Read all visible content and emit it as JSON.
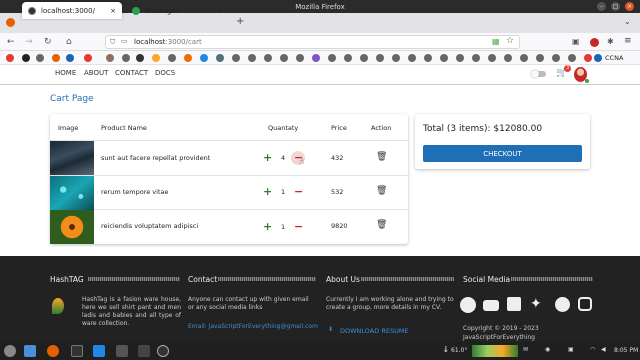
{
  "window": {
    "title": "Mozilla Firefox"
  },
  "tabs": [
    {
      "label": "localhost:3000/"
    },
    {
      "label": "Messages"
    }
  ],
  "url": {
    "host": "localhost",
    "rest": ":3000/cart"
  },
  "bookmarks": {
    "last_label": "CCNA"
  },
  "app_nav": {
    "items": [
      "HOME",
      "ABOUT",
      "CONTACT",
      "DOCS"
    ],
    "cart_badge": "3"
  },
  "cart": {
    "title": "Cart Page",
    "headers": {
      "image": "Image",
      "product": "Product Name",
      "quantity": "Quantaty",
      "price": "Price",
      "action": "Action"
    },
    "rows": [
      {
        "name": "sunt aut facere repellat provident",
        "qty": "4",
        "price": "432"
      },
      {
        "name": "rerum tempore vitae",
        "qty": "1",
        "price": "532"
      },
      {
        "name": "reiciendis voluptatem adipisci",
        "qty": "1",
        "price": "9820"
      }
    ],
    "total": "Total (3 items): $12080.00",
    "checkout": "CHECKOUT"
  },
  "footer": {
    "hashtag": {
      "title": "HashTAG",
      "text": "HashTag is a fasion ware house, here we sell shirt pant and men ladis and babies and all type of ware collection."
    },
    "contact": {
      "title": "Contact",
      "text": "Anyone can contact up with given email or any social media links",
      "email": "Email: JavaScriptForEverything@gmail.com"
    },
    "about": {
      "title": "About Us",
      "text": "Currently I am working alone and trying to create a group, more details in my CV.",
      "download": "DOWNLOAD RESUME"
    },
    "social": {
      "title": "Social Media",
      "copyright": "Copyright © 2019 - 2023",
      "brand": "JavaScriptForEverything"
    }
  },
  "taskbar": {
    "temp": "61.0°",
    "time": "8:05 PM"
  },
  "colors": {
    "accent": "#1e6fb5",
    "plus": "#2e7d32",
    "minus": "#c62828",
    "footer": "#222222"
  }
}
